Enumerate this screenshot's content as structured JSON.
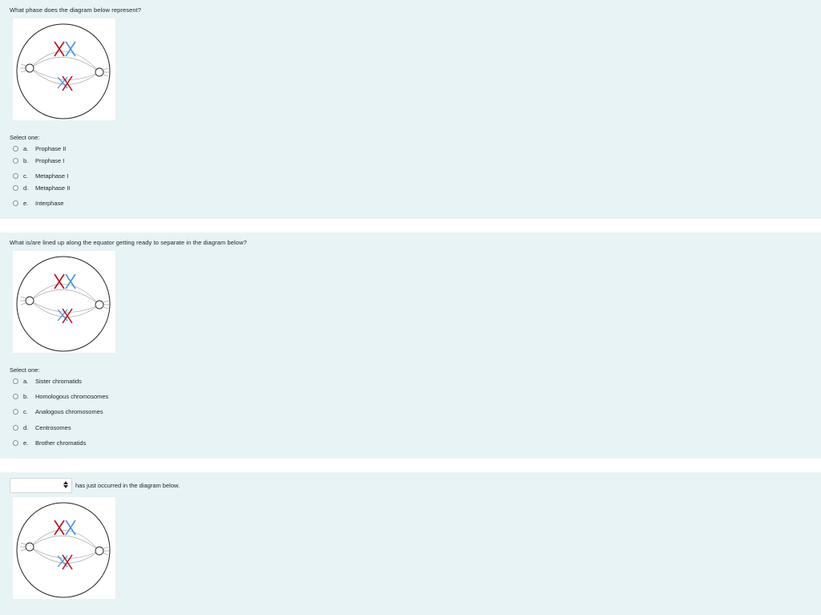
{
  "questions": [
    {
      "text": "What phase does the diagram below represent?",
      "select_label": "Select one:",
      "options": [
        {
          "letter": "a.",
          "label": "Prophase II"
        },
        {
          "letter": "b.",
          "label": "Prophase I"
        },
        {
          "letter": "c.",
          "label": "Metaphase I"
        },
        {
          "letter": "d.",
          "label": "Metaphase II"
        },
        {
          "letter": "e.",
          "label": "Interphase"
        }
      ]
    },
    {
      "text": "What is/are lined up along the equator getting ready to separate in the diagram below?",
      "select_label": "Select one:",
      "options": [
        {
          "letter": "a.",
          "label": "Sister chromatids"
        },
        {
          "letter": "b.",
          "label": "Homologous chromosomes"
        },
        {
          "letter": "c.",
          "label": "Analogous chromosomes"
        },
        {
          "letter": "d.",
          "label": "Centrosomes"
        },
        {
          "letter": "e.",
          "label": "Brother chromatids"
        }
      ]
    },
    {
      "dropdown_value": "",
      "dropdown_icon": "updown-caret-icon",
      "text": "has just occurred in the diagram below."
    }
  ],
  "colors": {
    "question_bg": "#e7f3f5",
    "chromosome_red": "#b5121b",
    "chromosome_blue": "#4a90e2"
  }
}
